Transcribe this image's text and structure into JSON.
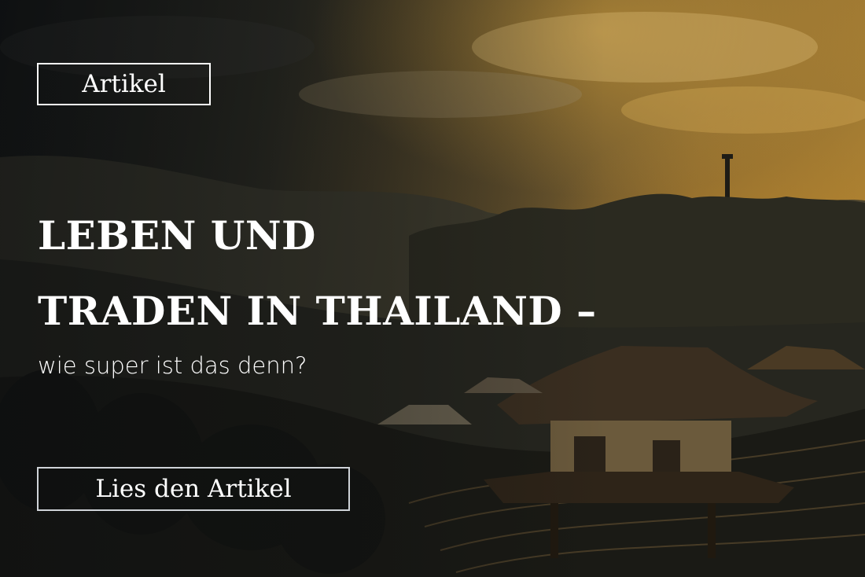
{
  "tag_label": "Artikel",
  "title_line1": "LEBEN UND",
  "title_line2": "TRADEN IN THAILAND –",
  "subtitle": "wie super ist das denn?",
  "cta_label": "Lies den Artikel",
  "colors": {
    "text": "#ffffff",
    "cta_border": "#cfd3d8",
    "tint_gold": "#b08534",
    "tint_dark": "#141616"
  }
}
